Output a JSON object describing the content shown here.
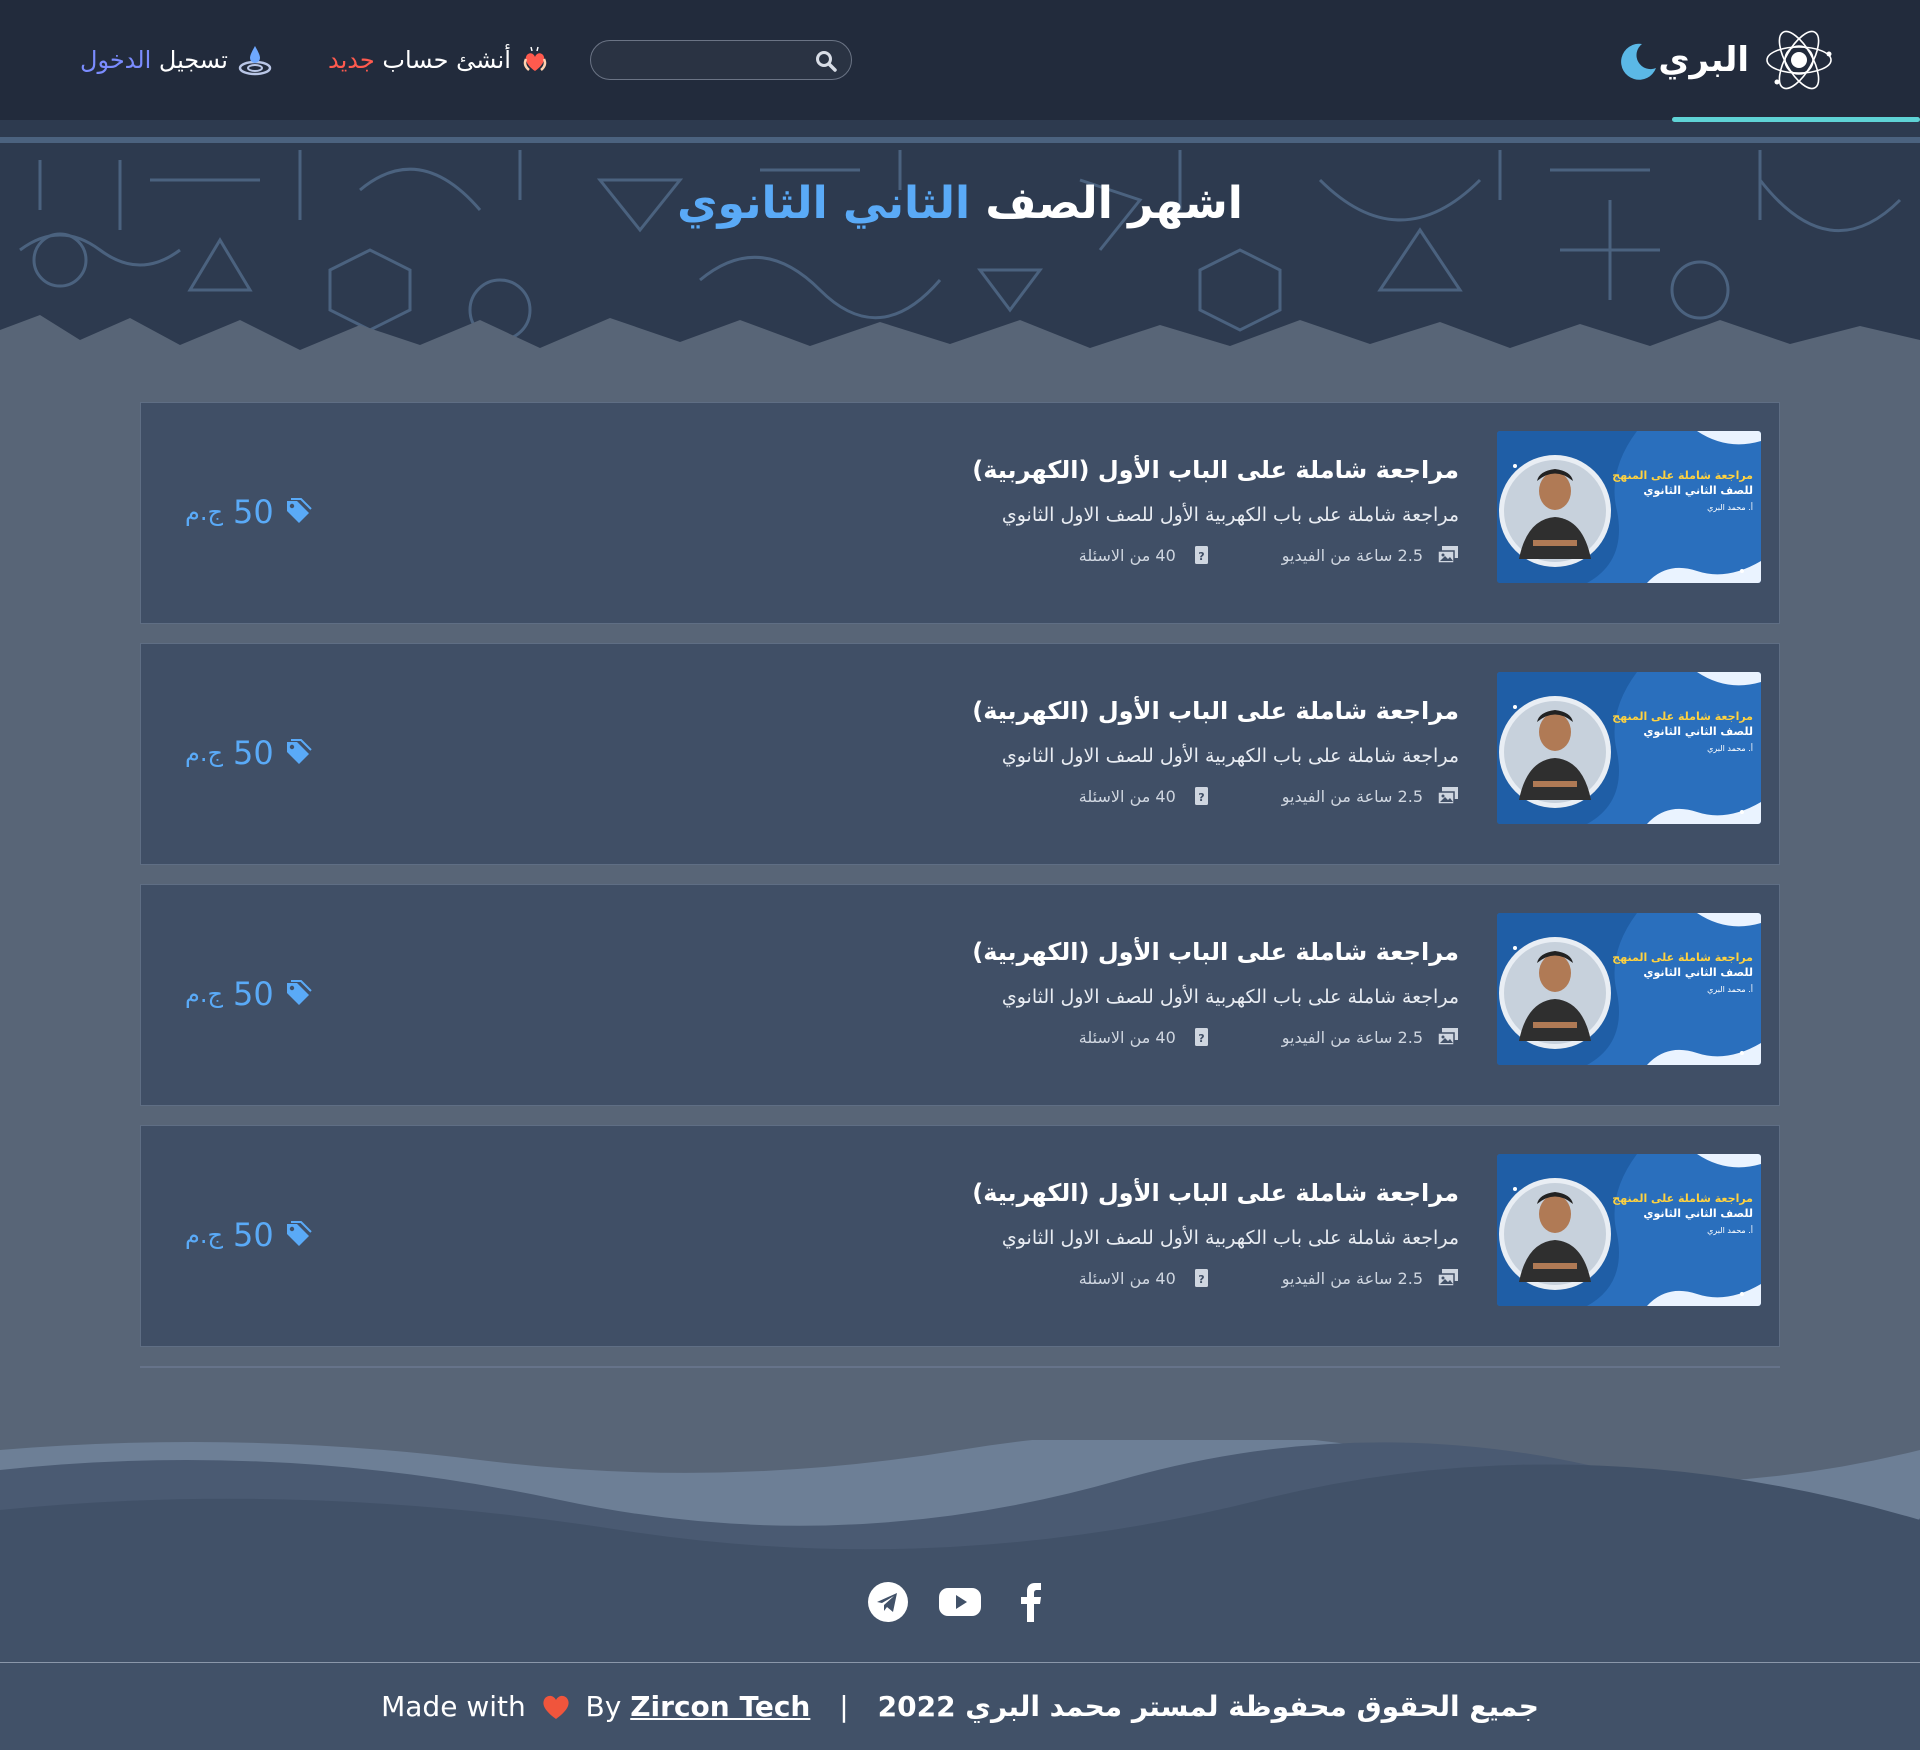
{
  "navbar": {
    "brand": "البري",
    "search_placeholder": "",
    "register": {
      "text": "أنشئ حساب",
      "accent": "جديد"
    },
    "login": {
      "text": "تسجيل",
      "accent": "الدخول"
    }
  },
  "hero": {
    "title_prefix": "اشهر الصف",
    "title_accent": "الثاني الثانوي"
  },
  "courses": [
    {
      "title": "مراجعة شاملة على الباب الأول (الكهربية)",
      "description": "مراجعة شاملة على باب الكهربية الأول للصف الاول الثانوي",
      "video_hours": "2.5",
      "video_label": "ساعة من الفيديو",
      "questions": "40",
      "questions_label": "من الاسئلة",
      "price": "50",
      "currency": "ج.م"
    },
    {
      "title": "مراجعة شاملة على الباب الأول (الكهربية)",
      "description": "مراجعة شاملة على باب الكهربية الأول للصف الاول الثانوي",
      "video_hours": "2.5",
      "video_label": "ساعة من الفيديو",
      "questions": "40",
      "questions_label": "من الاسئلة",
      "price": "50",
      "currency": "ج.م"
    },
    {
      "title": "مراجعة شاملة على الباب الأول (الكهربية)",
      "description": "مراجعة شاملة على باب الكهربية الأول للصف الاول الثانوي",
      "video_hours": "2.5",
      "video_label": "ساعة من الفيديو",
      "questions": "40",
      "questions_label": "من الاسئلة",
      "price": "50",
      "currency": "ج.م"
    },
    {
      "title": "مراجعة شاملة على الباب الأول (الكهربية)",
      "description": "مراجعة شاملة على باب الكهربية الأول للصف الاول الثانوي",
      "video_hours": "2.5",
      "video_label": "ساعة من الفيديو",
      "questions": "40",
      "questions_label": "من الاسئلة",
      "price": "50",
      "currency": "ج.م"
    }
  ],
  "thumbnail": {
    "headline": "مراجعة شاملة على المنهج",
    "subline": "للصف الثاني الثانوي",
    "teacher": "أ. محمد البري"
  },
  "footer": {
    "rights": "جميع الحقوق محفوظة لمستر محمد البري 2022",
    "separator": "|",
    "made_with": "Made with",
    "by": "By",
    "company": "Zircon Tech"
  },
  "colors": {
    "navbar_bg": "#222b3c",
    "page_bg": "#586577",
    "card_bg": "#404f66",
    "accent_blue": "#5aaaf7",
    "accent_red": "#ff5a4e",
    "accent_violet": "#7b8cff",
    "underline_teal": "#5fd3d6"
  },
  "icons": {
    "brand": "atom-logo-icon",
    "theme": "moon-icon",
    "search": "search-icon",
    "register": "heart-hands-icon",
    "login": "water-drop-icon",
    "video": "images-icon",
    "questions": "question-file-icon",
    "price": "tags-icon",
    "social": [
      "telegram-icon",
      "youtube-icon",
      "facebook-icon"
    ]
  }
}
